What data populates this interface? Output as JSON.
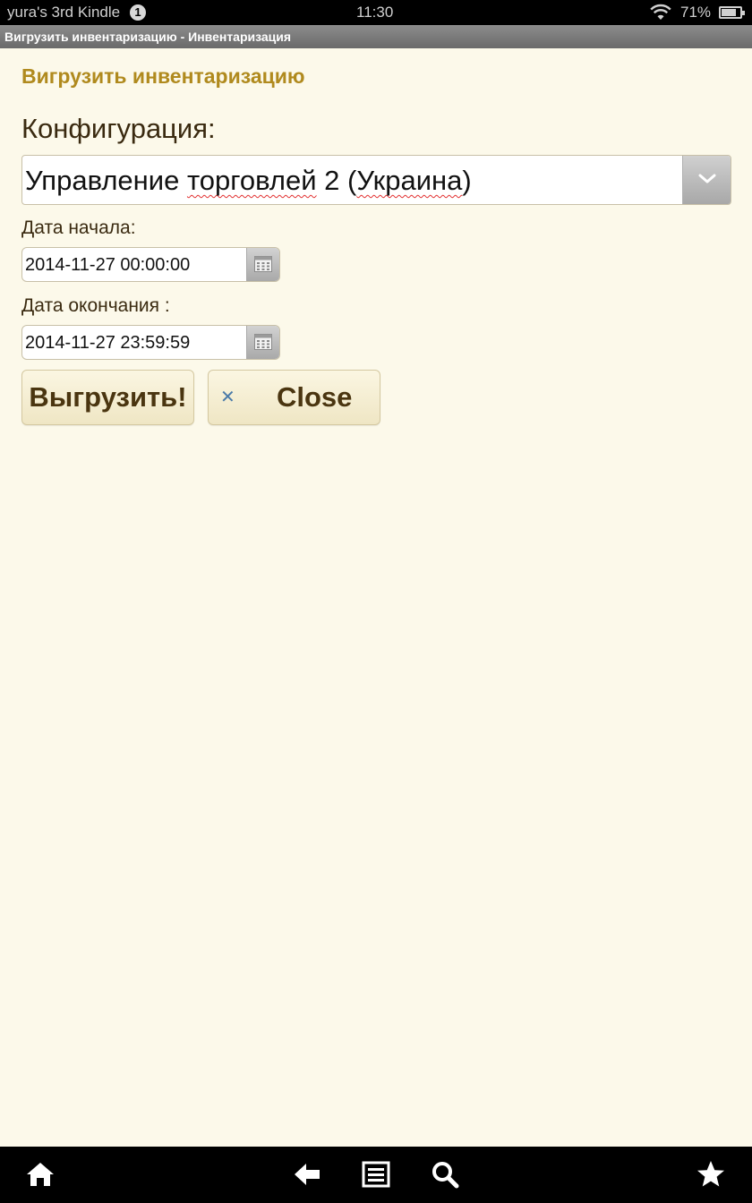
{
  "status_bar": {
    "device_name": "yura's 3rd Kindle",
    "notification_count": "1",
    "time": "11:30",
    "battery": "71%"
  },
  "title_bar": {
    "title": "Вигрузить инвентаризацию - Инвентаризация"
  },
  "form": {
    "heading": "Вигрузить инвентаризацию",
    "configuration_label": "Конфигурация:",
    "configuration_parts": [
      "Управление ",
      "торговлей",
      " 2 (",
      "Украина",
      ")"
    ],
    "start_date_label": "Дата начала:",
    "start_date_value": "2014-11-27 00:00:00",
    "end_date_label": "Дата окончания :",
    "end_date_value": "2014-11-27 23:59:59",
    "export_button": "Выгрузить!",
    "close_button": "Close"
  },
  "nav_bar": {
    "icons": [
      "home-icon",
      "back-icon",
      "menu-icon",
      "search-icon",
      "favorites-icon"
    ]
  },
  "colors": {
    "background": "#fcf9ea",
    "heading": "#b08a1e",
    "button_text": "#4a3510"
  }
}
